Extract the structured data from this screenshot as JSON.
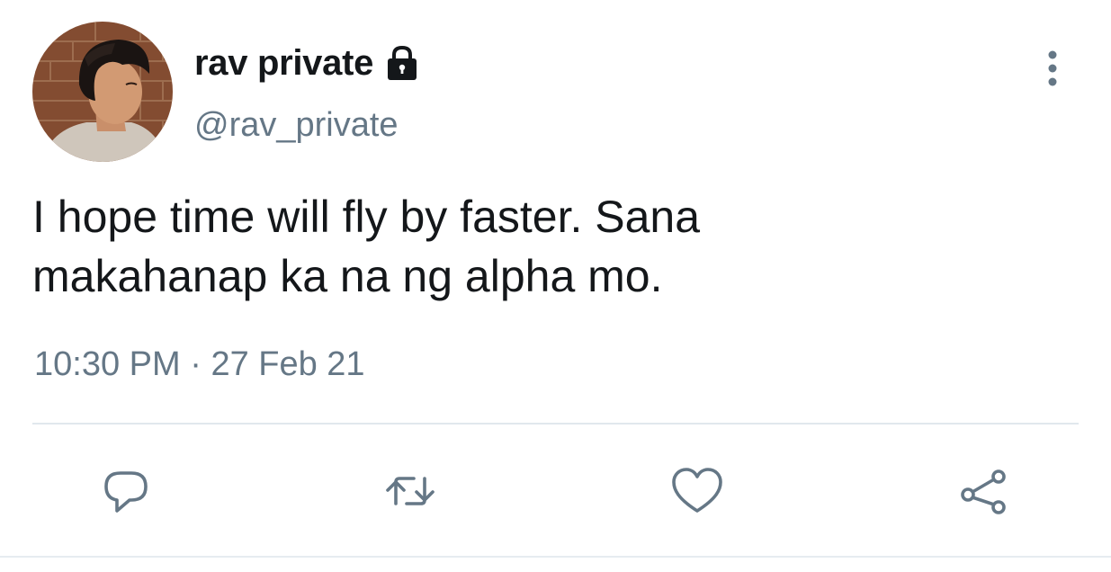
{
  "user": {
    "display_name": "rav private",
    "handle": "@rav_private",
    "protected_icon": "lock-icon",
    "avatar": "profile-photo"
  },
  "tweet": {
    "text_lines": [
      "I hope time will fly by faster. Sana",
      "makahanap ka na ng alpha mo."
    ],
    "time": "10:30 PM",
    "separator": " · ",
    "date": "27 Feb 21"
  },
  "actions": {
    "reply_icon": "reply-icon",
    "retweet_icon": "retweet-icon",
    "like_icon": "heart-icon",
    "share_icon": "share-icon"
  },
  "menu_icon": "more-vertical-icon",
  "colors": {
    "text_primary": "#14171a",
    "text_secondary": "#657786",
    "icon_gray": "#657786",
    "divider": "#e1e8ed"
  }
}
